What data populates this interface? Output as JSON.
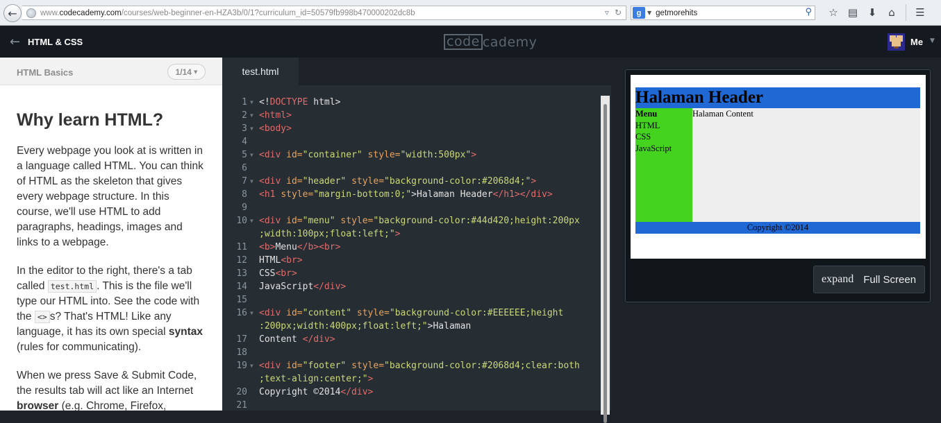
{
  "browser": {
    "url_prefix": "www.",
    "url_domain": "codecademy.com",
    "url_path": "/courses/web-beginner-en-HZA3b/0/1?curriculum_id=50579fb998b470000202dc8b",
    "search_value": "getmorehits",
    "search_engine_letter": "g"
  },
  "header": {
    "course_title": "HTML & CSS",
    "logo_code": "code",
    "logo_rest": "cademy",
    "user_name": "Me"
  },
  "lesson": {
    "unit_name": "HTML Basics",
    "progress": "1/14",
    "title": "Why learn HTML?",
    "p1": "Every webpage you look at is written in a language called HTML. You can think of HTML as the skeleton that gives every webpage structure. In this course, we'll use HTML to add paragraphs, headings, images and links to a webpage.",
    "p2_a": "In the editor to the right, there's a tab called ",
    "p2_code1": "test.html",
    "p2_b": ". This is the file we'll type our HTML into. See the code with the ",
    "p2_code2": "<>",
    "p2_c": "s? That's HTML! Like any language, it has its own special ",
    "p2_bold": "syntax",
    "p2_d": " (rules for communicating).",
    "p3_a": "When we press Save & Submit Code, the results tab will act like an Internet ",
    "p3_bold": "browser",
    "p3_b": " (e.g. Chrome, Firefox, Internet"
  },
  "editor": {
    "tab_name": "test.html",
    "line_numbers": [
      "1",
      "2",
      "3",
      "4",
      "5",
      "6",
      "7",
      "8",
      "9",
      "10",
      "",
      "11",
      "12",
      "13",
      "14",
      "15",
      "16",
      "",
      "17",
      "18",
      "19",
      "",
      "20",
      "21"
    ]
  },
  "result": {
    "header": "Halaman Header",
    "menu_title": "Menu",
    "menu_items": [
      "HTML",
      "CSS",
      "JavaScript"
    ],
    "content": "Halaman Content",
    "footer": "Copyright ©2014",
    "expand_label": "expand",
    "fullscreen_label": "Full Screen"
  },
  "colors": {
    "header_blue": "#2068d4",
    "menu_green": "#44d420",
    "content_grey": "#eeeeee"
  }
}
